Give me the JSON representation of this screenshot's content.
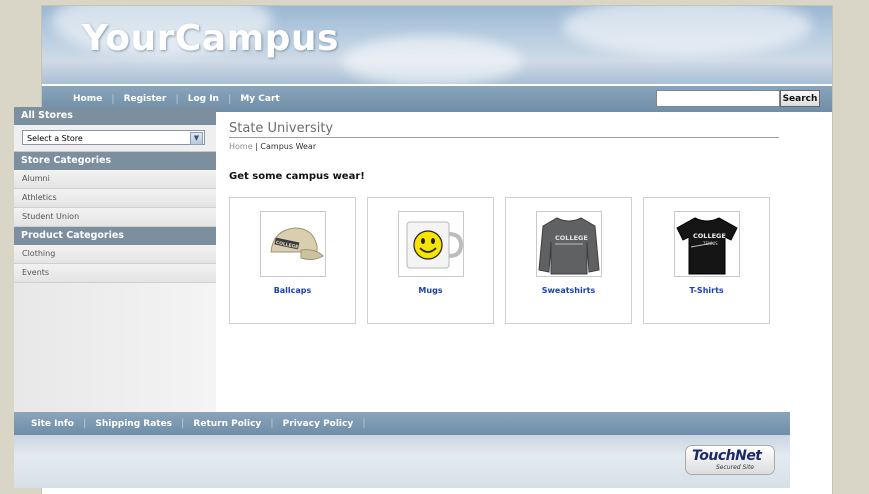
{
  "site": {
    "logo": "YourCampus"
  },
  "topnav": {
    "items": [
      "Home",
      "Register",
      "Log In",
      "My Cart"
    ]
  },
  "search": {
    "value": "",
    "placeholder": "",
    "button_label": "Search"
  },
  "sidebar": {
    "all_stores_heading": "All Stores",
    "store_select_value": "Select a Store",
    "store_categories_heading": "Store Categories",
    "store_categories": [
      "Alumni",
      "Athletics",
      "Student Union"
    ],
    "product_categories_heading": "Product Categories",
    "product_categories": [
      "Clothing",
      "Events"
    ]
  },
  "content": {
    "store_title": "State University",
    "breadcrumb": {
      "home": "Home",
      "separator": "|",
      "current": "Campus Wear"
    },
    "heading": "Get some campus wear!",
    "products": [
      {
        "label": "Ballcaps",
        "icon": "ballcap-icon"
      },
      {
        "label": "Mugs",
        "icon": "smiley-mug-icon"
      },
      {
        "label": "Sweatshirts",
        "icon": "sweatshirt-icon"
      },
      {
        "label": "T-Shirts",
        "icon": "tshirt-icon"
      }
    ],
    "product_art": {
      "cap_text": "COLLEGE",
      "sweatshirt_text": "COLLEGE",
      "tshirt_text": "COLLEGE",
      "tshirt_subtext": "TENNIS"
    }
  },
  "footer": {
    "links": [
      "Site Info",
      "Shipping Rates",
      "Return Policy",
      "Privacy Policy"
    ],
    "badge_name": "TouchNet",
    "badge_sub": "Secured Site"
  },
  "colors": {
    "nav_bar": "#7b96ae",
    "link_blue": "#1c3fae",
    "side_header": "#7b8f9f"
  }
}
